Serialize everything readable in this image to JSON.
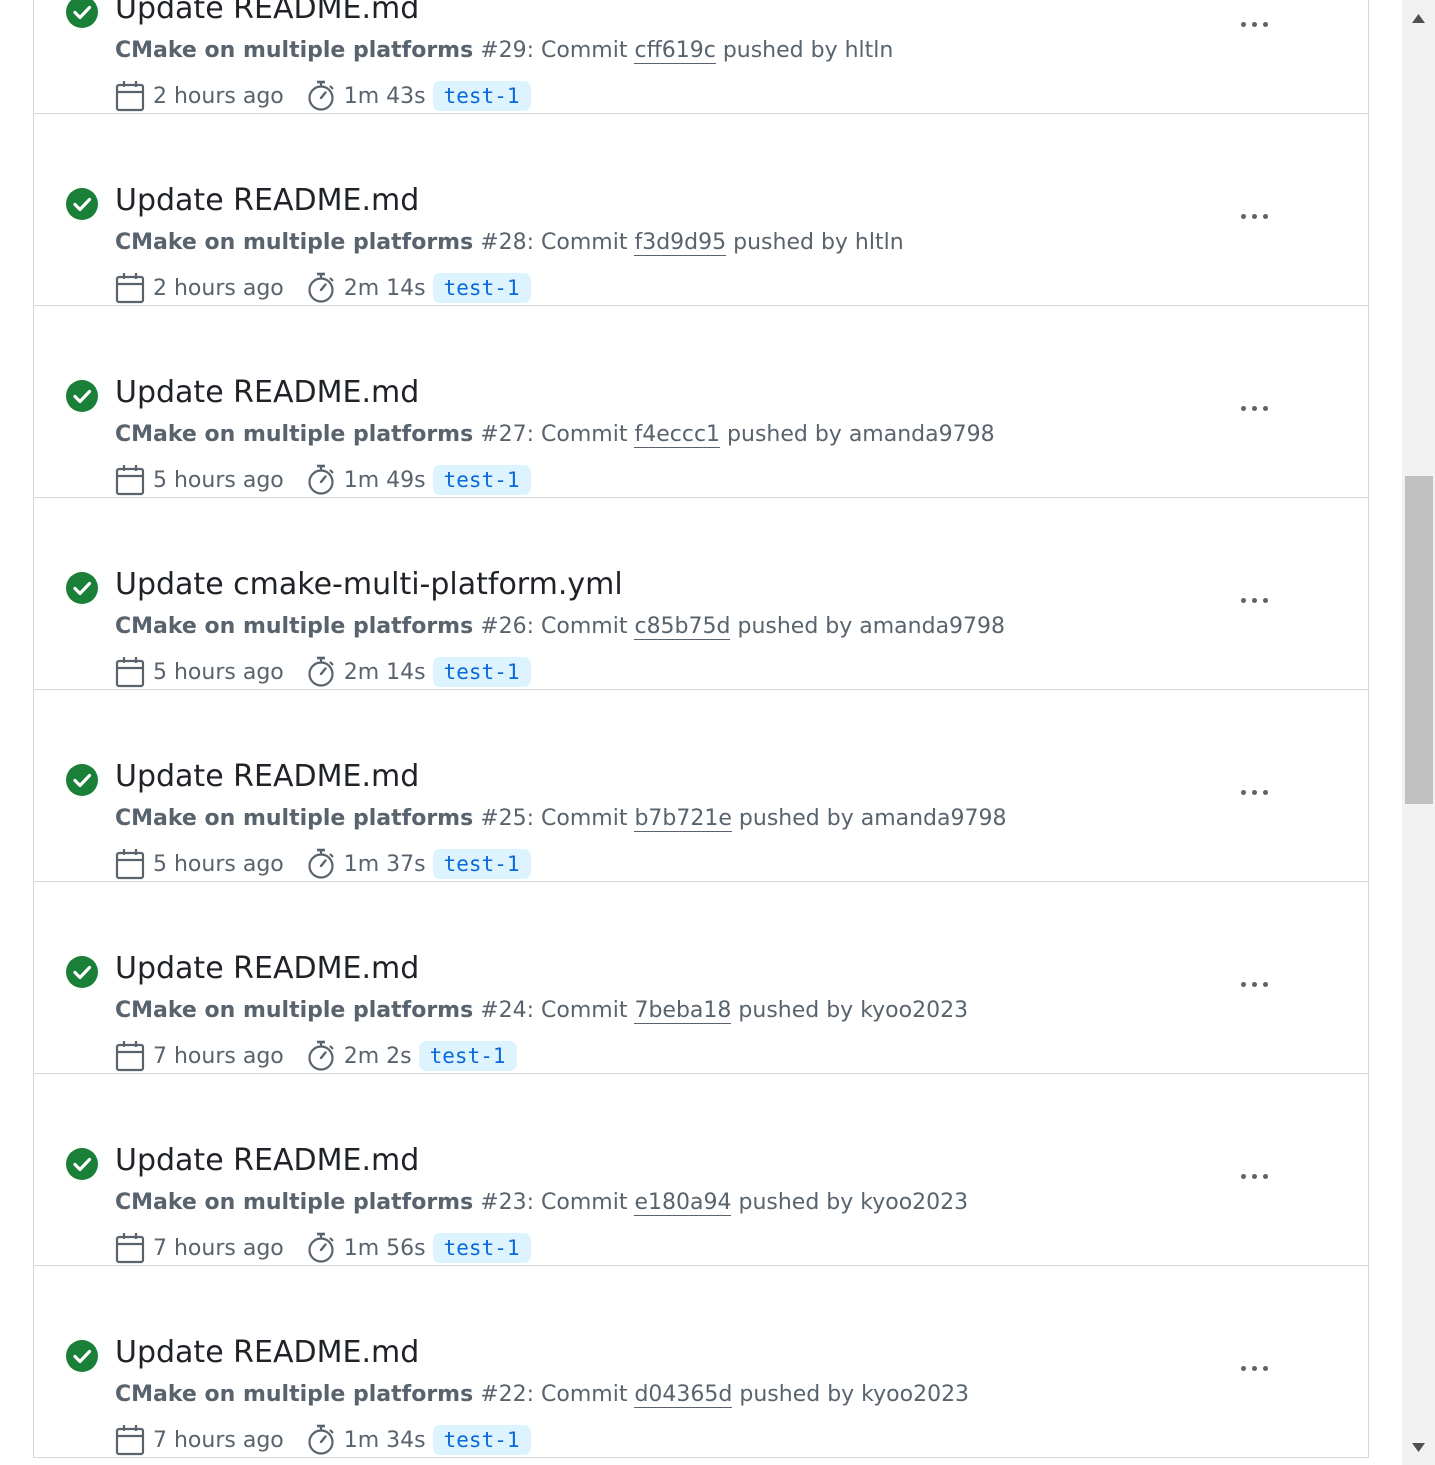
{
  "runs": [
    {
      "title": "Update README.md",
      "workflow": "CMake on multiple platforms",
      "number": "#29",
      "commit_label": ": Commit",
      "sha": "cff619c",
      "pushed_by": "pushed by hltln",
      "when": "2 hours ago",
      "duration": "1m 43s",
      "branch": "test-1",
      "status": "success"
    },
    {
      "title": "Update README.md",
      "workflow": "CMake on multiple platforms",
      "number": "#28",
      "commit_label": ": Commit",
      "sha": "f3d9d95",
      "pushed_by": "pushed by hltln",
      "when": "2 hours ago",
      "duration": "2m 14s",
      "branch": "test-1",
      "status": "success"
    },
    {
      "title": "Update README.md",
      "workflow": "CMake on multiple platforms",
      "number": "#27",
      "commit_label": ": Commit",
      "sha": "f4eccc1",
      "pushed_by": "pushed by amanda9798",
      "when": "5 hours ago",
      "duration": "1m 49s",
      "branch": "test-1",
      "status": "success"
    },
    {
      "title": "Update cmake-multi-platform.yml",
      "workflow": "CMake on multiple platforms",
      "number": "#26",
      "commit_label": ": Commit",
      "sha": "c85b75d",
      "pushed_by": "pushed by amanda9798",
      "when": "5 hours ago",
      "duration": "2m 14s",
      "branch": "test-1",
      "status": "success"
    },
    {
      "title": "Update README.md",
      "workflow": "CMake on multiple platforms",
      "number": "#25",
      "commit_label": ": Commit",
      "sha": "b7b721e",
      "pushed_by": "pushed by amanda9798",
      "when": "5 hours ago",
      "duration": "1m 37s",
      "branch": "test-1",
      "status": "success"
    },
    {
      "title": "Update README.md",
      "workflow": "CMake on multiple platforms",
      "number": "#24",
      "commit_label": ": Commit",
      "sha": "7beba18",
      "pushed_by": "pushed by kyoo2023",
      "when": "7 hours ago",
      "duration": "2m 2s",
      "branch": "test-1",
      "status": "success"
    },
    {
      "title": "Update README.md",
      "workflow": "CMake on multiple platforms",
      "number": "#23",
      "commit_label": ": Commit",
      "sha": "e180a94",
      "pushed_by": "pushed by kyoo2023",
      "when": "7 hours ago",
      "duration": "1m 56s",
      "branch": "test-1",
      "status": "success"
    },
    {
      "title": "Update README.md",
      "workflow": "CMake on multiple platforms",
      "number": "#22",
      "commit_label": ": Commit",
      "sha": "d04365d",
      "pushed_by": "pushed by kyoo2023",
      "when": "7 hours ago",
      "duration": "1m 34s",
      "branch": "test-1",
      "status": "success"
    }
  ],
  "icons": {
    "status": "check-circle-fill-icon",
    "date": "calendar-icon",
    "duration": "stopwatch-icon",
    "menu": "kebab-horizontal-icon"
  },
  "colors": {
    "success": "#1a7f37",
    "text_primary": "#1f2328",
    "text_muted": "#59636e",
    "branch_text": "#0969da",
    "branch_bg": "#ddf4ff",
    "border": "#d0d7de"
  }
}
